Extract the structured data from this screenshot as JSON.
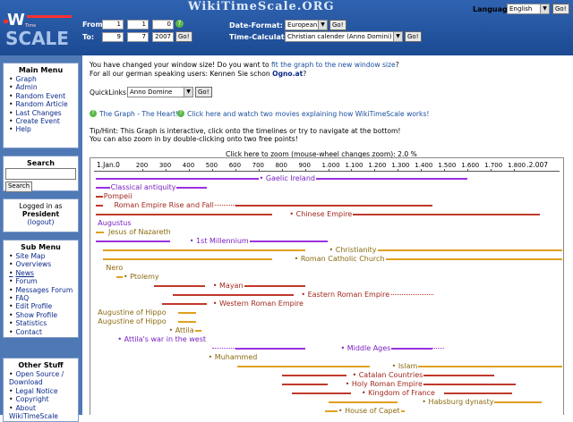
{
  "header": {
    "site_name": "WikiTimeScale.ORG",
    "logo_top": "Wiki",
    "logo_bottom": "SCALE",
    "from_label": "From:",
    "to_label": "To:",
    "from": {
      "day": "1",
      "month": "1",
      "year": "0"
    },
    "to": {
      "day": "9",
      "month": "7",
      "year": "2007"
    },
    "go_label": "Go!",
    "help_label": "?",
    "date_format_label": "Date-Format:",
    "date_format_value": "European",
    "time_calc_label": "Time-Calculation:",
    "time_calc_value": "Christian calender (Anno Domini)",
    "language_label": "Language:",
    "language_value": "English"
  },
  "sidebar": {
    "main_menu": {
      "title": "Main Menu",
      "items": [
        "Graph",
        "Admin",
        "Random Event",
        "Random Article",
        "Last Changes",
        "Create Event",
        "Help"
      ]
    },
    "search": {
      "title": "Search",
      "button": "Search"
    },
    "login": {
      "line1": "Logged in as",
      "user": "President",
      "logout": "(logout)"
    },
    "sub_menu": {
      "title": "Sub Menu",
      "items": [
        "Site Map",
        "Overviews",
        "News",
        "Forum",
        "Messages Forum",
        "FAQ",
        "Edit Profile",
        "Show Profile",
        "Statistics",
        "Contact"
      ]
    },
    "other": {
      "title": "Other Stuff",
      "items": [
        "Open Source / Download",
        "Legal Notice",
        "Copyright",
        "About WikiTimeScale"
      ]
    }
  },
  "main": {
    "notice_1": "You have changed your window size! Do you want to",
    "notice_link": "fit the graph to the new window size",
    "notice_end": "?",
    "notice_2a": "For all our german speaking users: Kennen Sie schon",
    "notice_2_link": "Ogno.at",
    "notice_2b": "?",
    "quicklinks_label": "QuickLinks:",
    "quicklinks_value": "Anno Domine",
    "quicklinks_go": "Go!",
    "link_graph": "The Graph - The Heart!",
    "link_movies": "Click here and watch two movies explaining how WikiTimeScale works!",
    "tip_1": "Tip/Hint: This Graph is interactive, click onto the timelines or try to navigate at the bottom!",
    "tip_2": "You can also zoom in by double-clicking onto two free points!",
    "zoom_text": "Click here to zoom (mouse-wheel changes zoom): 2.0 %"
  },
  "chart_data": {
    "type": "timeline",
    "xlim": [
      0,
      2007
    ],
    "start_label": "1.Jan.0",
    "end_label": "9.Jul.2.007",
    "ticks": [
      "200",
      "300",
      "400",
      "500",
      "600",
      "700",
      "800",
      "900",
      "1.000",
      "1.100",
      "1.200",
      "1.300",
      "1.400",
      "1.500",
      "1.600",
      "1.700",
      "1.800"
    ],
    "rows": [
      {
        "name": "Gaelic Ireland",
        "label_x": 700,
        "color": "#9b30e0",
        "segments": [
          [
            0,
            1600
          ]
        ],
        "dots": []
      },
      {
        "name": "Classical antiquity",
        "label_x": 60,
        "color": "#9b30e0",
        "segments": [
          [
            0,
            476
          ]
        ],
        "dots": []
      },
      {
        "name": "Pompeii",
        "label_x": 30,
        "color": "#c0392b",
        "segments": [
          [
            0,
            79
          ]
        ],
        "dots": []
      },
      {
        "name": "Roman Empire Rise and Fall",
        "label_x": 75,
        "color": "#c0392b",
        "segments": [
          [
            0,
            30
          ],
          [
            600,
            1450
          ]
        ],
        "dots": [
          [
            476,
            600
          ]
        ]
      },
      {
        "name": "Chinese Empire",
        "label_x": 830,
        "color": "#c0392b",
        "segments": [
          [
            0,
            760
          ],
          [
            1050,
            1911
          ]
        ],
        "dots": []
      },
      {
        "name": "Augustus",
        "label_x": 5,
        "color": "#9b30e0",
        "segments": [],
        "dots": []
      },
      {
        "name": "Jesus of Nazareth",
        "label_x": 50,
        "color": "#e0a020",
        "segments": [
          [
            0,
            33
          ]
        ],
        "dots": []
      },
      {
        "name": "1st Millennium",
        "label_x": 400,
        "color": "#9b30e0",
        "segments": [
          [
            0,
            320
          ],
          [
            600,
            1000
          ]
        ],
        "dots": []
      },
      {
        "name": "Christianity",
        "label_x": 1000,
        "color": "#e0a020",
        "segments": [
          [
            30,
            900
          ],
          [
            1150,
            2007
          ]
        ],
        "dots": []
      },
      {
        "name": "Roman Catholic Church",
        "label_x": 850,
        "color": "#e0a020",
        "segments": [
          [
            30,
            760
          ],
          [
            1250,
            2007
          ]
        ],
        "dots": []
      },
      {
        "name": "Nero",
        "label_x": 40,
        "color": "#e0a020",
        "segments": [
          [
            37,
            68
          ]
        ],
        "dots": []
      },
      {
        "name": "Ptolemy",
        "label_x": 115,
        "color": "#e0a020",
        "segments": [
          [
            90,
            168
          ]
        ],
        "dots": []
      },
      {
        "name": "Mayan",
        "label_x": 500,
        "color": "#c0392b",
        "segments": [
          [
            250,
            470
          ],
          [
            640,
            900
          ]
        ],
        "dots": []
      },
      {
        "name": "Eastern Roman Empire",
        "label_x": 880,
        "color": "#c0392b",
        "segments": [
          [
            330,
            850
          ]
        ],
        "dots": [
          [
            1200,
            1453
          ]
        ]
      },
      {
        "name": "Western Roman Empire",
        "label_x": 500,
        "color": "#c0392b",
        "segments": [
          [
            286,
            476
          ]
        ],
        "dots": []
      },
      {
        "name": "Augustine of Hippo",
        "label_x": 5,
        "color": "#e0a020",
        "segments": [
          [
            354,
            430
          ]
        ],
        "dots": []
      },
      {
        "name": "Augustine of Hippo",
        "label_x": 5,
        "color": "#e0a020",
        "segments": [
          [
            354,
            430
          ]
        ],
        "dots": []
      },
      {
        "name": "Attila",
        "label_x": 310,
        "color": "#e0a020",
        "segments": [
          [
            406,
            453
          ]
        ],
        "dots": []
      },
      {
        "name": "Attila's war in the west",
        "label_x": 90,
        "color": "#9b30e0",
        "segments": [
          [
            434,
            453
          ]
        ],
        "dots": []
      },
      {
        "name": "Middle Ages",
        "label_x": 1050,
        "color": "#9b30e0",
        "segments": [
          [
            600,
            900
          ],
          [
            1200,
            1450
          ]
        ],
        "dots": [
          [
            500,
            600
          ],
          [
            1450,
            1500
          ]
        ]
      },
      {
        "name": "Muhammed",
        "label_x": 480,
        "color": "#e0a020",
        "segments": [
          [
            570,
            632
          ]
        ],
        "dots": []
      },
      {
        "name": "Islam",
        "label_x": 1270,
        "color": "#e0a020",
        "segments": [
          [
            610,
            1180
          ],
          [
            1370,
            2007
          ]
        ],
        "dots": []
      },
      {
        "name": "Catalan Countries",
        "label_x": 1100,
        "color": "#c0392b",
        "segments": [
          [
            800,
            1080
          ],
          [
            1350,
            1714
          ]
        ],
        "dots": []
      },
      {
        "name": "Holy Roman Empire",
        "label_x": 1070,
        "color": "#c0392b",
        "segments": [
          [
            800,
            1000
          ],
          [
            1400,
            1806
          ]
        ],
        "dots": []
      },
      {
        "name": "Kingdom of France",
        "label_x": 1140,
        "color": "#c0392b",
        "segments": [
          [
            843,
            1100
          ],
          [
            1500,
            1792
          ]
        ],
        "dots": []
      },
      {
        "name": "Habsburg dynasty",
        "label_x": 1400,
        "color": "#e0a020",
        "segments": [
          [
            1000,
            1300
          ],
          [
            1700,
            1918
          ]
        ],
        "dots": []
      },
      {
        "name": "House of Capet",
        "label_x": 1040,
        "color": "#e0a020",
        "segments": [
          [
            987,
            1050
          ],
          [
            1250,
            1328
          ]
        ],
        "dots": []
      }
    ]
  }
}
